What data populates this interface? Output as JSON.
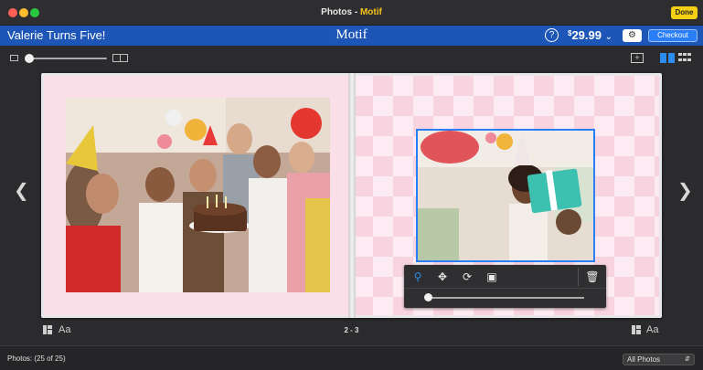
{
  "window": {
    "title_prefix": "Photos - ",
    "title_app": "Motif",
    "done_label": "Done"
  },
  "header": {
    "book_title": "Valerie Turns Five!",
    "brand": "Motif",
    "help_symbol": "?",
    "price_currency": "$",
    "price_amount": "29.99",
    "price_chevron": "⌄",
    "checkout_label": "Checkout",
    "settings_icon": "gear-icon"
  },
  "toolbar": {
    "zoom_level": 0
  },
  "spread": {
    "page_numbers": "2 - 3"
  },
  "page_footer": {
    "left_text_label": "Aa",
    "right_text_label": "Aa"
  },
  "status": {
    "photos_label": "Photos:",
    "photos_count": "(25 of 25)",
    "filter_value": "All Photos",
    "filter_chevron": "⌃⌄"
  },
  "colors": {
    "accent": "#2a7ef6",
    "header_blue": "#1d56b6",
    "done_yellow": "#f5cf12",
    "page_pink": "#fbdfe8"
  }
}
